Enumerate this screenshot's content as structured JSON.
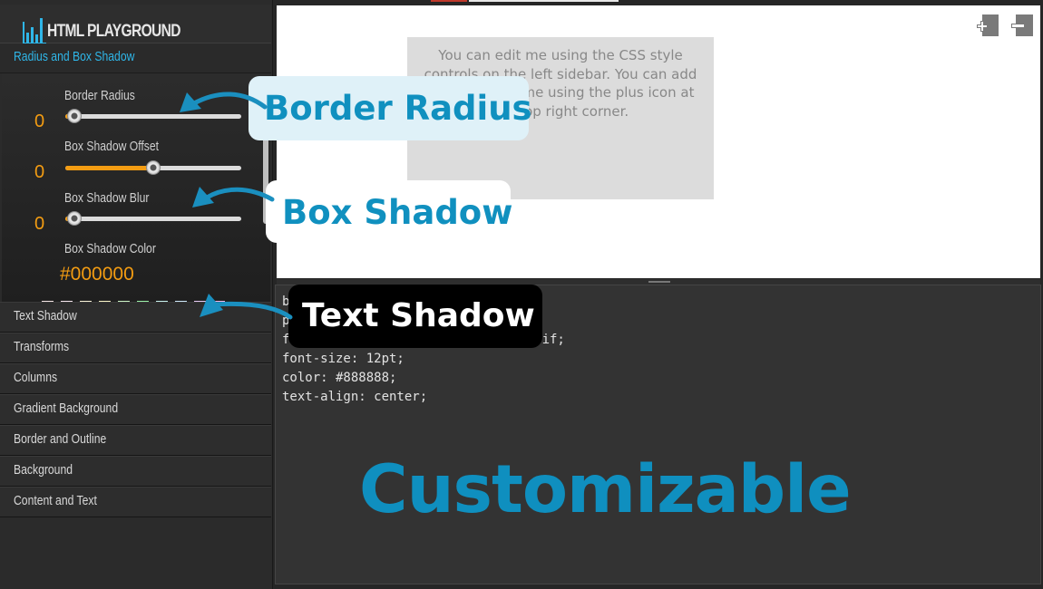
{
  "app": {
    "logo_text": "HTML PLAYGROUND"
  },
  "sidebar": {
    "section_title": "Radius and Box Shadow",
    "controls": [
      {
        "label": "Border Radius",
        "value": "0",
        "slider_fraction": 0.05
      },
      {
        "label": "Box Shadow Offset",
        "value": "0",
        "slider_fraction": 0.5
      },
      {
        "label": "Box Shadow Blur",
        "value": "0",
        "slider_fraction": 0.05
      }
    ],
    "color_label": "Box Shadow Color",
    "color_value": "#000000",
    "swatches": [
      "#f5e6e6",
      "#f7e7f0",
      "#f9f3d9",
      "#fbf7c9",
      "#cdf5c6",
      "#9cf3a9",
      "#c9f3f0",
      "#cfe9fb",
      "#e7cdf6",
      "#f3b5e8"
    ],
    "menu": [
      "Text Shadow",
      "Transforms",
      "Columns",
      "Gradient Background",
      "Border and Outline",
      "Background",
      "Content and Text"
    ]
  },
  "preview": {
    "demo_text": "You can edit me using the CSS style controls on the left sidebar. You can add elements like me using the plus icon at the top right corner."
  },
  "editor": {
    "code_lines": [
      "b",
      "p",
      "f                          ans-serif;",
      "font-size: 12pt;",
      "color: #888888;",
      "text-align: center;"
    ]
  },
  "annotations": {
    "border_radius": "Border Radius",
    "box_shadow": "Box Shadow",
    "text_shadow": "Text Shadow",
    "caption": "Customizable"
  },
  "colors": {
    "accent_orange": "#f39c12",
    "accent_blue": "#2fb6e8",
    "callout_blue": "#1090bf",
    "arrow_blue": "#1a8fbf"
  },
  "icons": {
    "add_element": "add-element-icon",
    "remove_element": "remove-element-icon"
  }
}
